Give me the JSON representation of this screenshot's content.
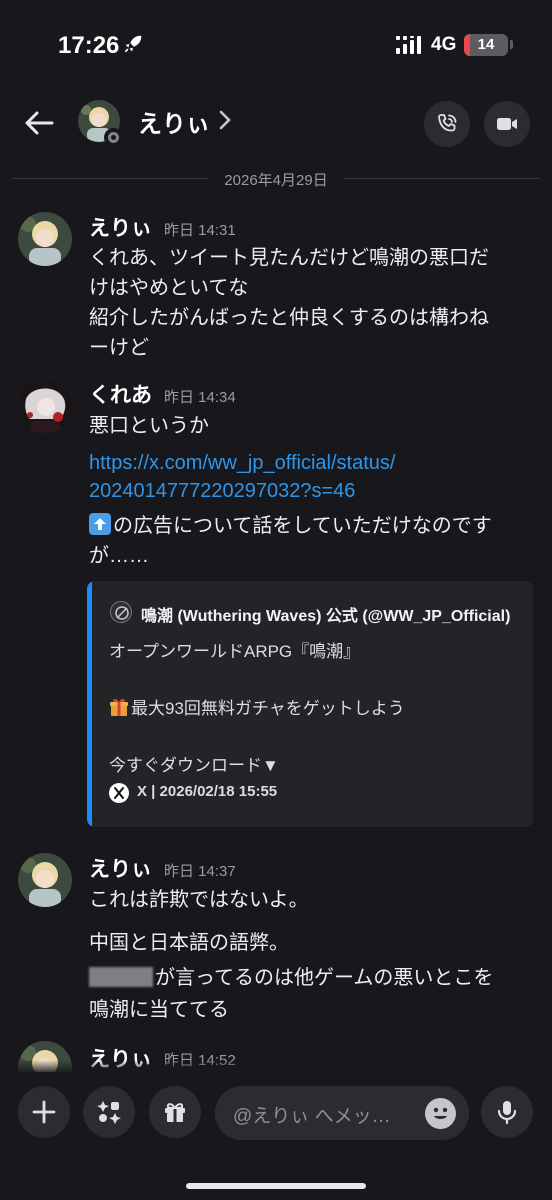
{
  "status_bar": {
    "time": "17:26",
    "network": "4G",
    "battery": "14",
    "battery_level": 0.14
  },
  "header": {
    "name": "えりぃ",
    "chevron": "›"
  },
  "date_divider": "2026年4月29日",
  "messages": [
    {
      "author": "えりぃ",
      "timestamp": "昨日 14:31",
      "lines": [
        "くれあ、ツイート見たんだけど鳴潮の悪口だ",
        "けはやめといてな",
        "紹介したがんばったと仲良くするのは構わね",
        "ーけど"
      ]
    },
    {
      "author": "くれあ",
      "timestamp": "昨日 14:34",
      "line1": "悪口というか",
      "link_lines": [
        "https://x.com/ww_jp_official/status/",
        "2024014777220297032?s=46"
      ],
      "line_after_emoji": "の広告について話をしていただけなのです",
      "line_last": "が……",
      "embed": {
        "author": "鳴潮 (Wuthering Waves) 公式 (@WW_JP_Official)",
        "line1": "オープンワールドARPG『鳴潮』",
        "line2": "最大93回無料ガチャをゲットしよう",
        "line3": "今すぐダウンロード▼",
        "footer": "X | 2026/02/18 15:55"
      }
    },
    {
      "author": "えりぃ",
      "timestamp": "昨日 14:37",
      "line1": "これは詐欺ではないよ。",
      "line2": "中国と日本語の語弊。",
      "line3_after_redact": "が言ってるのは他ゲームの悪いとこを",
      "line4": "鳴潮に当ててる"
    },
    {
      "author": "えりぃ",
      "timestamp": "昨日 14:52"
    }
  ],
  "composer": {
    "placeholder": "@えりぃ へメッ…"
  },
  "icons": {
    "back": "arrow-left-icon",
    "call": "phone-icon",
    "video": "video-camera-icon",
    "add": "plus-icon",
    "apps": "apps-icon",
    "gift": "gift-icon",
    "emoji": "emoji-icon",
    "mic": "microphone-icon"
  },
  "colors": {
    "background": "#18181c",
    "link": "#2f95e8",
    "embed_accent": "#1a8cff",
    "battery_low": "#e5484d"
  }
}
